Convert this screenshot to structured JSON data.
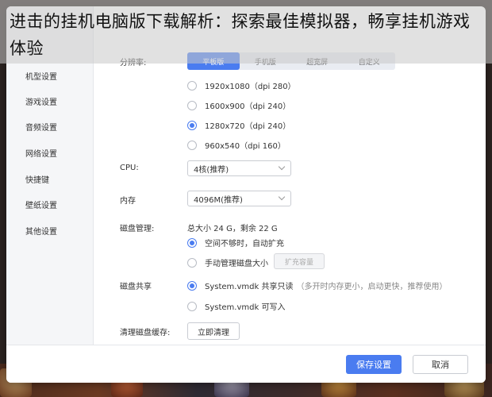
{
  "overlay_title": "进击的挂机电脑版下载解析：探索最佳模拟器，畅享挂机游戏体验",
  "sidebar": {
    "items": [
      {
        "label": "机型设置"
      },
      {
        "label": "游戏设置"
      },
      {
        "label": "音频设置"
      },
      {
        "label": "网络设置"
      },
      {
        "label": "快捷键"
      },
      {
        "label": "壁纸设置"
      },
      {
        "label": "其他设置"
      }
    ]
  },
  "resolution": {
    "label": "分辨率:",
    "tabs": [
      {
        "label": "平板版"
      },
      {
        "label": "手机版"
      },
      {
        "label": "超宽屏"
      },
      {
        "label": "自定义"
      }
    ],
    "options": [
      {
        "label": "1920x1080（dpi 280）",
        "checked": false
      },
      {
        "label": "1600x900（dpi 240）",
        "checked": false
      },
      {
        "label": "1280x720（dpi 240）",
        "checked": true
      },
      {
        "label": "960x540（dpi 160）",
        "checked": false
      }
    ]
  },
  "cpu": {
    "label": "CPU:",
    "value": "4核(推荐)"
  },
  "memory": {
    "label": "内存",
    "value": "4096M(推荐)"
  },
  "disk": {
    "label": "磁盘管理:",
    "summary": "总大小 24 G，剩余 22 G",
    "options": [
      {
        "label": "空间不够时，自动扩充",
        "checked": true
      },
      {
        "label": "手动管理磁盘大小",
        "checked": false
      }
    ],
    "expand_button": "扩充容量"
  },
  "share": {
    "label": "磁盘共享",
    "options": [
      {
        "label": "System.vmdk 共享只读",
        "hint": "（多开时内存更小，启动更快，推荐使用）",
        "checked": true
      },
      {
        "label": "System.vmdk 可写入",
        "hint": "",
        "checked": false
      }
    ]
  },
  "cache": {
    "label": "清理磁盘缓存:",
    "button": "立即清理"
  },
  "footer": {
    "save": "保存设置",
    "cancel": "取消"
  },
  "colors": {
    "accent": "#4a7cf0"
  }
}
